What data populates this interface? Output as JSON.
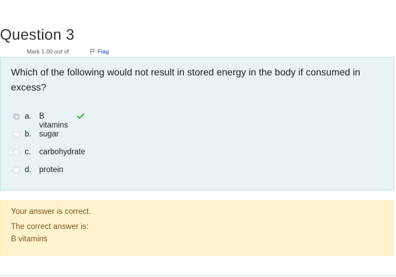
{
  "question": {
    "title": "Question 3",
    "mark": "Mark 1.00 out of",
    "flag_label": "Flag",
    "text": "Which of the following would not result in stored energy in the body if consumed in excess?"
  },
  "answers": [
    {
      "letter": "a.",
      "label": "B vitamins",
      "selected": true,
      "correct": true
    },
    {
      "letter": "b.",
      "label": "sugar",
      "selected": false
    },
    {
      "letter": "c.",
      "label": "carbohydrate",
      "selected": false
    },
    {
      "letter": "d.",
      "label": "protein",
      "selected": false
    }
  ],
  "feedback": {
    "result": "Your answer is correct.",
    "correct_heading": "The correct answer is:",
    "correct_answer": "B vitamins"
  },
  "colors": {
    "question_bg": "#e7f3f5",
    "feedback_bg": "#fff3cd",
    "correct_check": "#3aa335",
    "flag_link": "#0f47ad"
  },
  "icons": {
    "flag": "flag-icon",
    "correct": "check-icon"
  }
}
